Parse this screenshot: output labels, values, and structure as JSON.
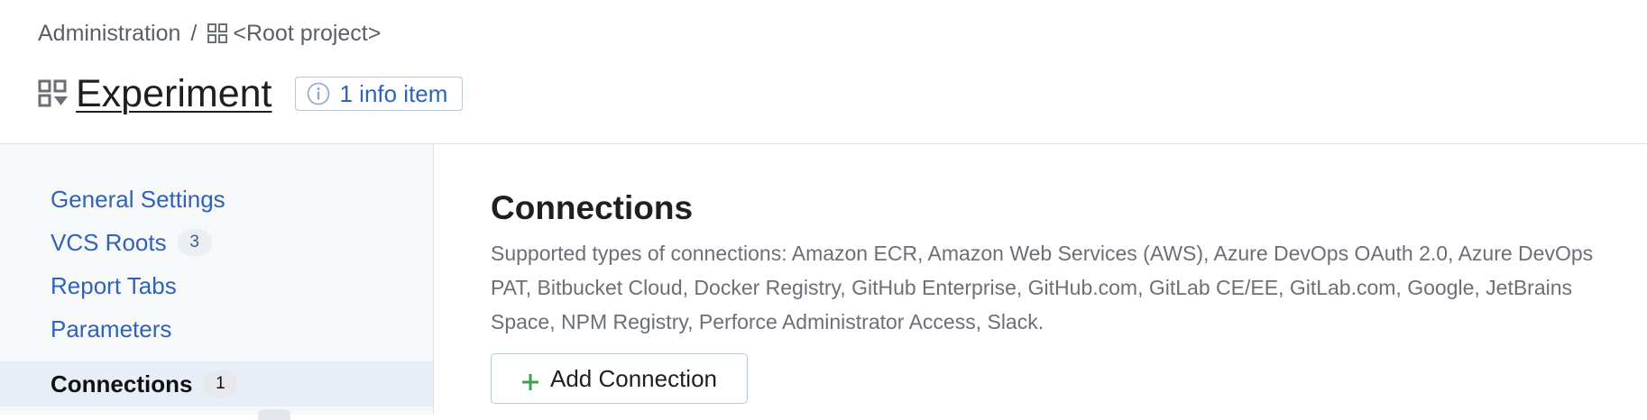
{
  "breadcrumb": {
    "admin_label": "Administration",
    "separator": "/",
    "project_label": "<Root project>"
  },
  "title": {
    "text": "Experiment",
    "info_badge": "1 info item"
  },
  "sidebar": {
    "items": [
      {
        "label": "General Settings",
        "count": null,
        "active": false
      },
      {
        "label": "VCS Roots",
        "count": "3",
        "active": false
      },
      {
        "label": "Report Tabs",
        "count": null,
        "active": false
      },
      {
        "label": "Parameters",
        "count": null,
        "active": false
      },
      {
        "label": "Connections",
        "count": "1",
        "active": true
      }
    ]
  },
  "main": {
    "section_title": "Connections",
    "description": "Supported types of connections: Amazon ECR, Amazon Web Services (AWS), Azure DevOps OAuth 2.0, Azure DevOps PAT, Bitbucket Cloud, Docker Registry, GitHub Enterprise, GitHub.com, GitLab CE/EE, GitLab.com, Google, JetBrains Space, NPM Registry, Perforce Administrator Access, Slack.",
    "add_button_label": "Add Connection"
  },
  "icons": {
    "project": "project-grid-icon",
    "build_config": "build-config-icon",
    "info": "info-circle-icon",
    "add": "plus-icon"
  },
  "colors": {
    "link": "#2f63b8",
    "text": "#1f1f1f",
    "muted": "#6b6f76",
    "sidebar_bg": "#f7f8fa",
    "active_bg": "#e8eef8",
    "add_green": "#3aa148",
    "border": "#dcdfe4"
  }
}
